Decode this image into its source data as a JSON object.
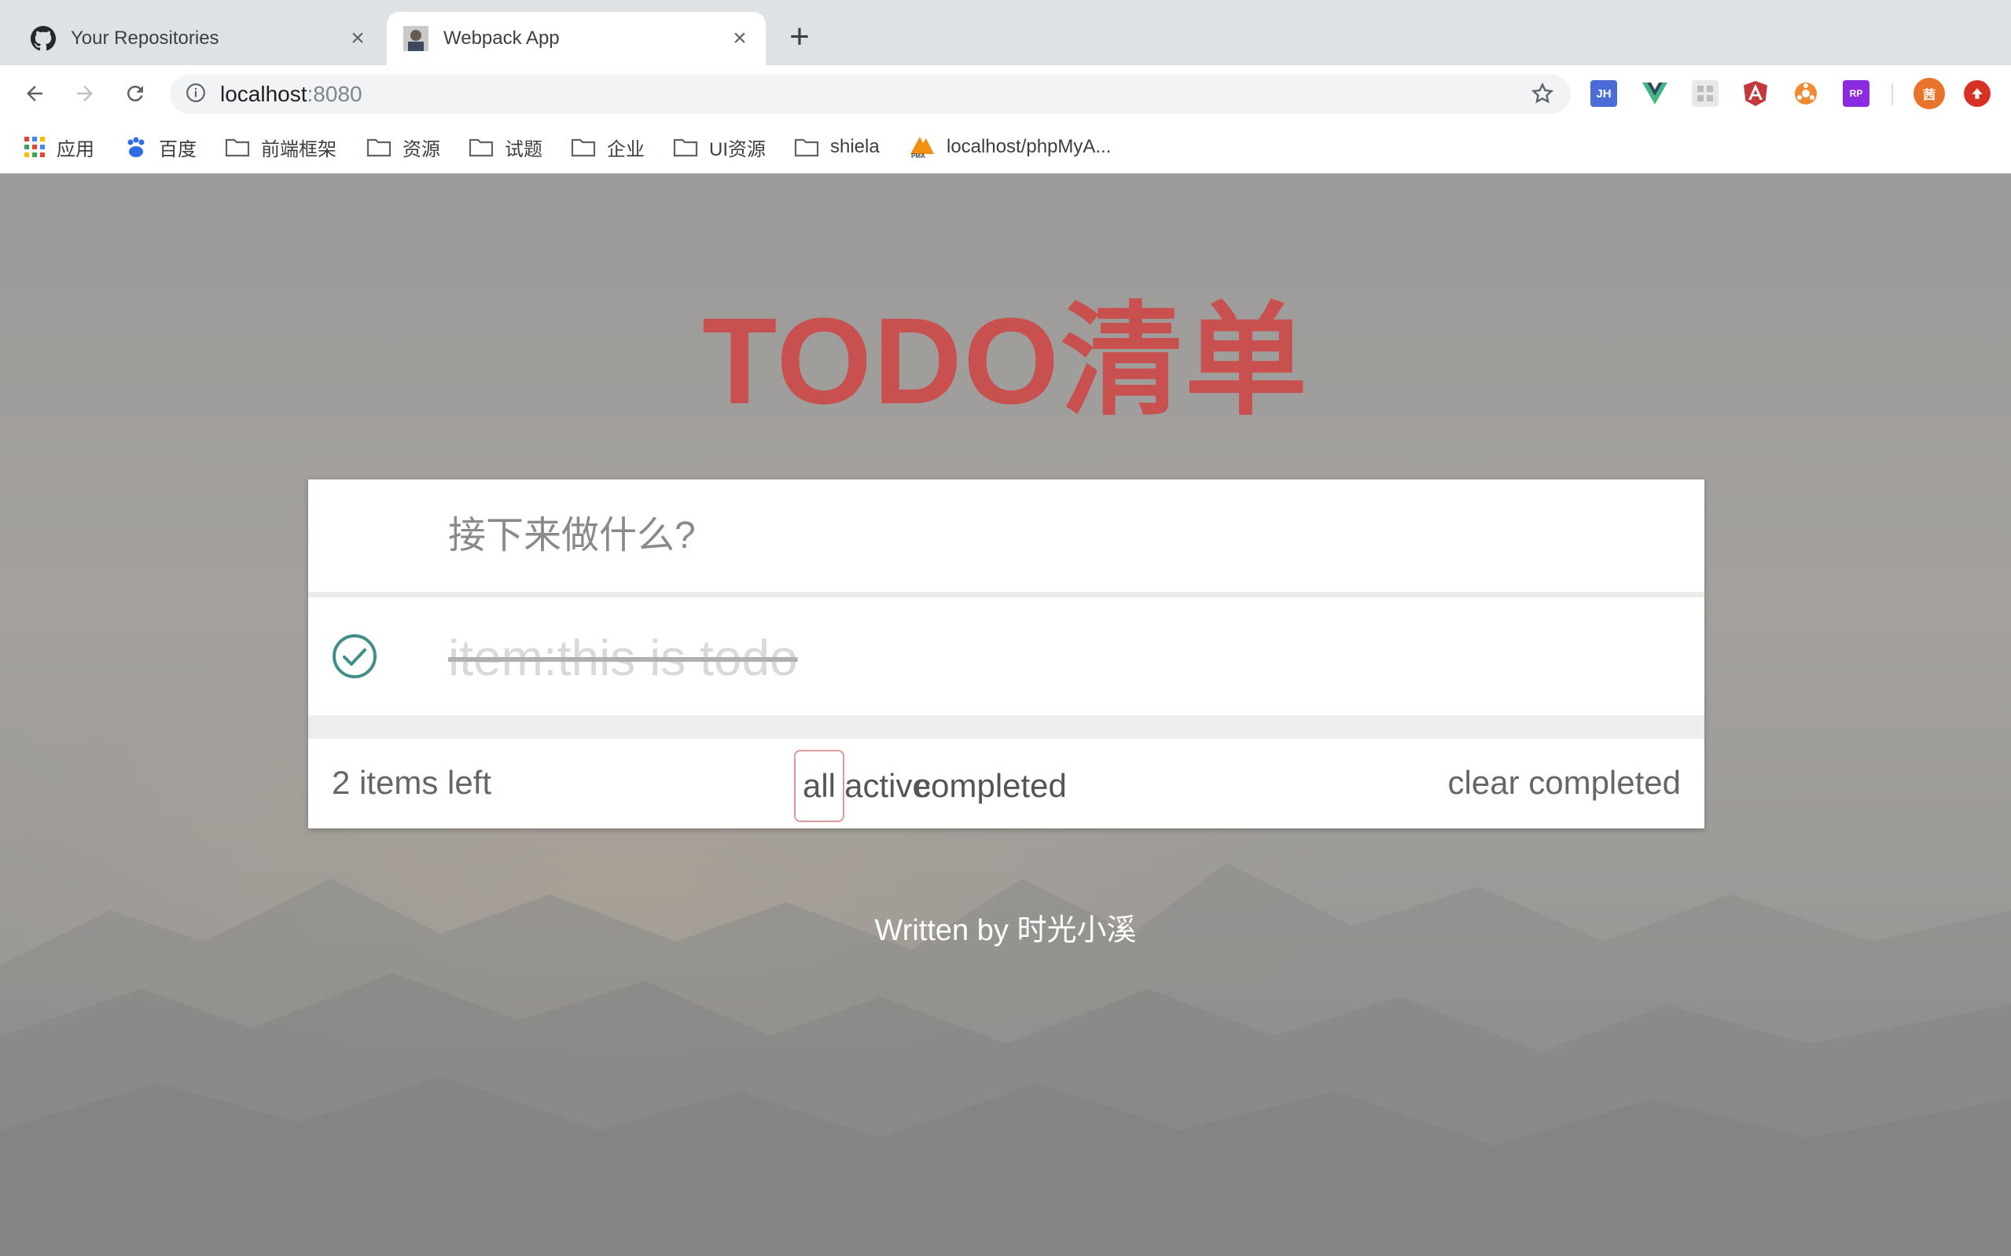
{
  "browser": {
    "tabs": [
      {
        "title": "Your Repositories",
        "icon": "github-icon",
        "active": false
      },
      {
        "title": "Webpack App",
        "icon": "avatar-favicon",
        "active": true
      }
    ],
    "address_bar": {
      "host": "localhost",
      "port": ":8080"
    },
    "extensions": [
      {
        "name": "jh-extension-icon",
        "label": "JH",
        "color": "#4b6bd6"
      },
      {
        "name": "vue-devtools-icon",
        "label": "",
        "color": "#41b883"
      },
      {
        "name": "grid-extension-icon",
        "label": "",
        "color": "#d0d0d0"
      },
      {
        "name": "angular-extension-icon",
        "label": "A",
        "color": "#c3383b"
      },
      {
        "name": "orange-extension-icon",
        "label": "",
        "color": "#f08a30"
      },
      {
        "name": "rp-extension-icon",
        "label": "RP",
        "color": "#8a2be2"
      },
      {
        "name": "profile-avatar-icon",
        "label": "茜",
        "color": "#e8742c"
      },
      {
        "name": "update-extension-icon",
        "label": "",
        "color": "#d93025"
      }
    ],
    "bookmarks": [
      {
        "label": "应用",
        "icon": "apps-grid-icon"
      },
      {
        "label": "百度",
        "icon": "baidu-paw-icon"
      },
      {
        "label": "前端框架",
        "icon": "folder-icon"
      },
      {
        "label": "资源",
        "icon": "folder-icon"
      },
      {
        "label": "试题",
        "icon": "folder-icon"
      },
      {
        "label": "企业",
        "icon": "folder-icon"
      },
      {
        "label": "UI资源",
        "icon": "folder-icon"
      },
      {
        "label": "shiela",
        "icon": "folder-icon"
      },
      {
        "label": "localhost/phpMyA...",
        "icon": "phpmyadmin-icon"
      }
    ]
  },
  "app": {
    "title": "TODO清单",
    "input_placeholder": "接下来做什么?",
    "todos": [
      {
        "text": "item:this is todo",
        "completed": true
      }
    ],
    "footer": {
      "items_left": "2 items left",
      "filters": [
        "all",
        "active",
        "completed"
      ],
      "selected_filter": "all",
      "clear_label": "clear completed"
    },
    "credit": "Written by 时光小溪",
    "colors": {
      "title": "#c8514f",
      "check": "#3f8f87",
      "selected_filter_border": "#d99a9a"
    }
  }
}
